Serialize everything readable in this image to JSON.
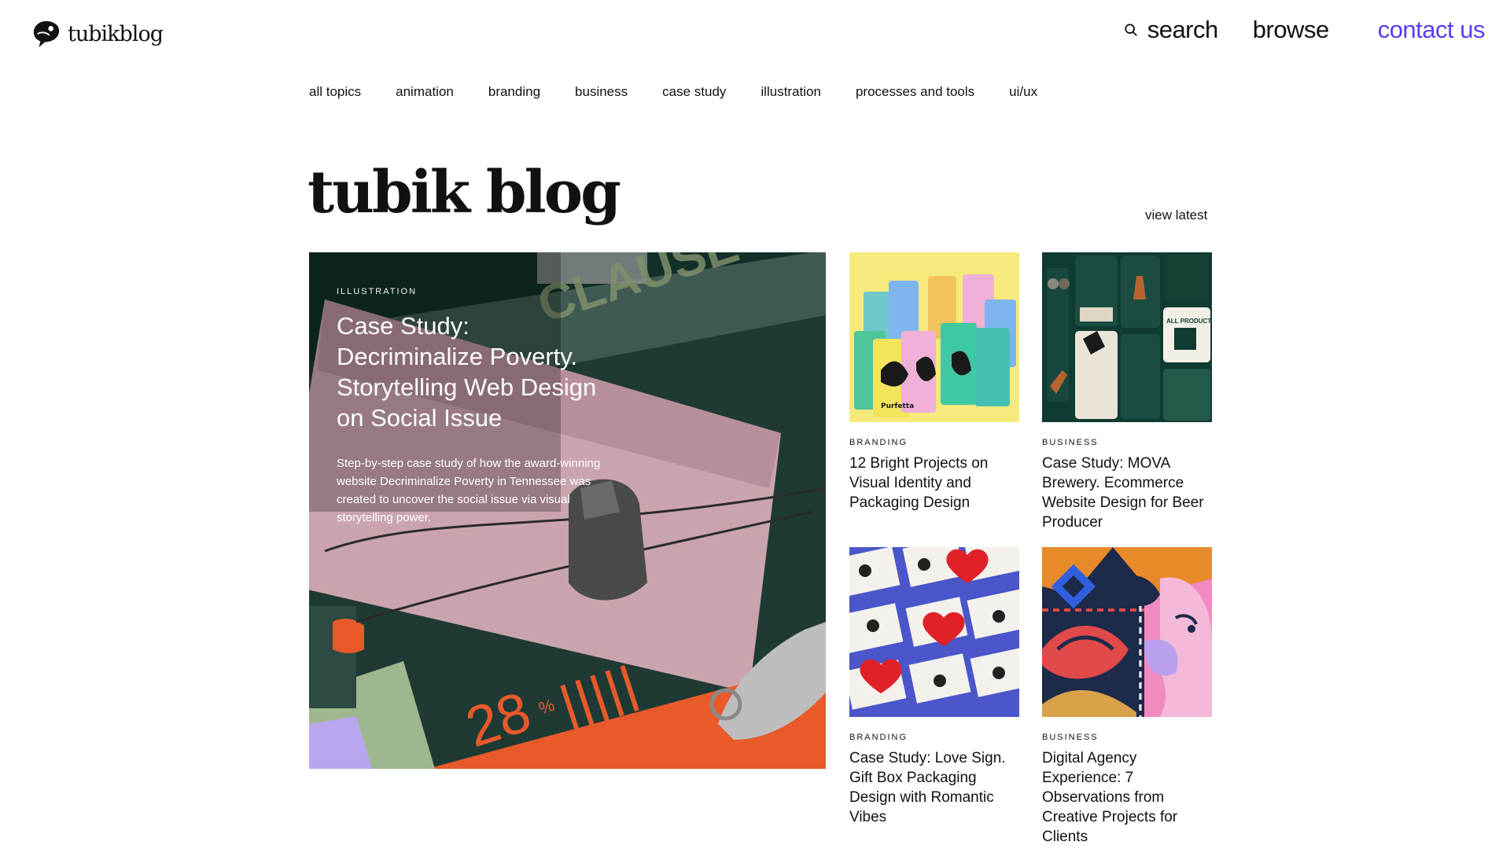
{
  "header": {
    "logo_text": "tubikblog",
    "search_label": "search",
    "browse_label": "browse",
    "contact_label": "contact us",
    "accent_color": "#5a3cf0"
  },
  "topics": [
    "all topics",
    "animation",
    "branding",
    "business",
    "case study",
    "illustration",
    "processes and tools",
    "ui/ux"
  ],
  "page": {
    "title": "tubik blog",
    "view_latest": "view latest"
  },
  "feature": {
    "category": "ILLUSTRATION",
    "title": "Case Study: Decriminalize Poverty. Storytelling Web Design on Social Issue",
    "description": "Step-by-step case study of how the award-winning website Decriminalize Poverty in Tennessee was created to uncover the social issue via visual storytelling power.",
    "image_texts": {
      "clause": "CLAUSE",
      "percent": "28",
      "percent_sign": "%"
    }
  },
  "cards": [
    {
      "category": "BRANDING",
      "title": "12 Bright Projects on Visual Identity and Packaging Design",
      "image_text": "Purfetta"
    },
    {
      "category": "BUSINESS",
      "title": "Case Study: MOVA Brewery. Ecommerce Website Design for Beer Producer",
      "image_text": "ALL PRODUCTS"
    },
    {
      "category": "BRANDING",
      "title": "Case Study: Love Sign. Gift Box Packaging Design with Romantic Vibes",
      "image_text": ""
    },
    {
      "category": "BUSINESS",
      "title": "Digital Agency Experience: 7 Observations from Creative Projects for Clients",
      "image_text": ""
    }
  ]
}
